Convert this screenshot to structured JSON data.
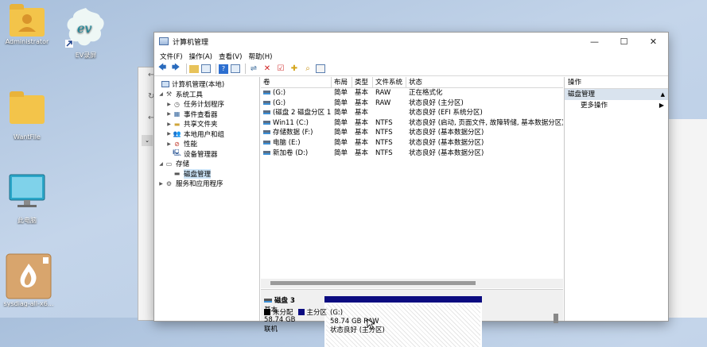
{
  "desktop": {
    "icons": [
      {
        "label": "Administrator"
      },
      {
        "label": "EV录屏"
      },
      {
        "label": "WantFile"
      },
      {
        "label": "此电脑"
      },
      {
        "label": "sysdiag-all-x6..."
      }
    ]
  },
  "window": {
    "title": "计算机管理",
    "controls": {
      "minimize": "—",
      "maximize": "☐",
      "close": "✕"
    },
    "menu": [
      "文件(F)",
      "操作(A)",
      "查看(V)",
      "帮助(H)"
    ]
  },
  "tree": [
    {
      "label": "计算机管理(本地)"
    },
    {
      "label": "系统工具"
    },
    {
      "label": "任务计划程序"
    },
    {
      "label": "事件查看器"
    },
    {
      "label": "共享文件夹"
    },
    {
      "label": "本地用户和组"
    },
    {
      "label": "性能"
    },
    {
      "label": "设备管理器"
    },
    {
      "label": "存储"
    },
    {
      "label": "磁盘管理"
    },
    {
      "label": "服务和应用程序"
    }
  ],
  "volumes": {
    "headers": [
      "卷",
      "布局",
      "类型",
      "文件系统",
      "状态"
    ],
    "rows": [
      [
        "(G:)",
        "简单",
        "基本",
        "RAW",
        "正在格式化"
      ],
      [
        "(G:)",
        "简单",
        "基本",
        "RAW",
        "状态良好 (主分区)"
      ],
      [
        "(磁盘 2 磁盘分区 1)",
        "简单",
        "基本",
        "",
        "状态良好 (EFI 系统分区)"
      ],
      [
        "Win11 (C:)",
        "简单",
        "基本",
        "NTFS",
        "状态良好 (启动, 页面文件, 故障转储, 基本数据分区)"
      ],
      [
        "存储数据 (F:)",
        "简单",
        "基本",
        "NTFS",
        "状态良好 (基本数据分区)"
      ],
      [
        "电脑 (E:)",
        "简单",
        "基本",
        "NTFS",
        "状态良好 (基本数据分区)"
      ],
      [
        "新加卷 (D:)",
        "简单",
        "基本",
        "NTFS",
        "状态良好 (基本数据分区)"
      ]
    ]
  },
  "disk": {
    "name": "磁盘 3",
    "type": "基本",
    "size": "58.74 GB",
    "status": "联机",
    "partition": {
      "name": "(G:)",
      "info": "58.74 GB RAW",
      "status": "状态良好 (主分区)"
    }
  },
  "legend": {
    "unallocated": "未分配",
    "primary": "主分区",
    "unallocated_color": "#000000",
    "primary_color": "#0b0b80"
  },
  "actions": {
    "header": "操作",
    "section": "磁盘管理",
    "more": "更多操作"
  }
}
